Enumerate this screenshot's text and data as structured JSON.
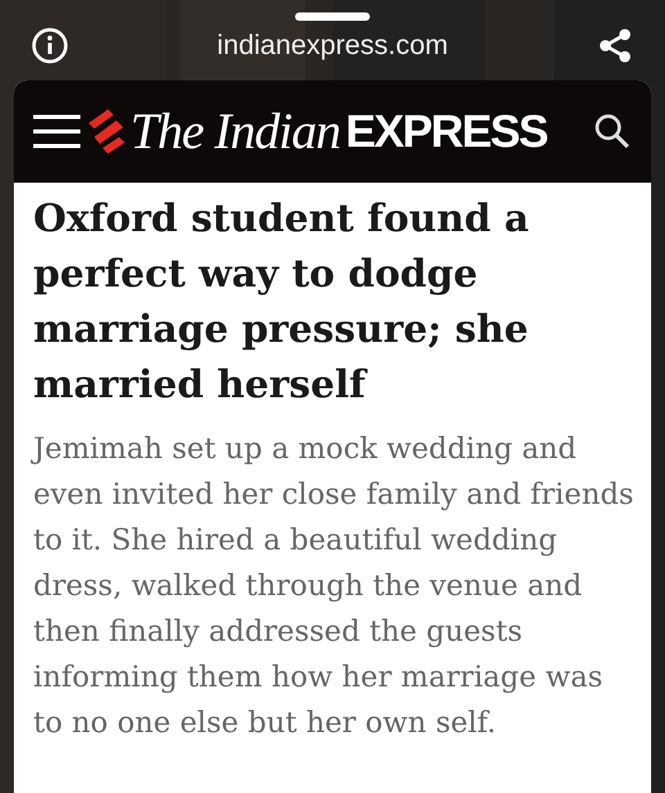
{
  "browser_bar": {
    "url": "indianexpress.com"
  },
  "site_header": {
    "logo": {
      "italic_part": "The Indian",
      "bold_part": "EXPRESS"
    }
  },
  "article": {
    "headline": "Oxford student found a perfect way to dodge marriage pressure; she married herself",
    "summary": "Jemimah set up a mock wedding and even invited her close family and friends to it. She hired a beautiful wedding dress, walked through the venue and then finally addressed the guests informing them how her marriage was to no one else but her own self."
  }
}
